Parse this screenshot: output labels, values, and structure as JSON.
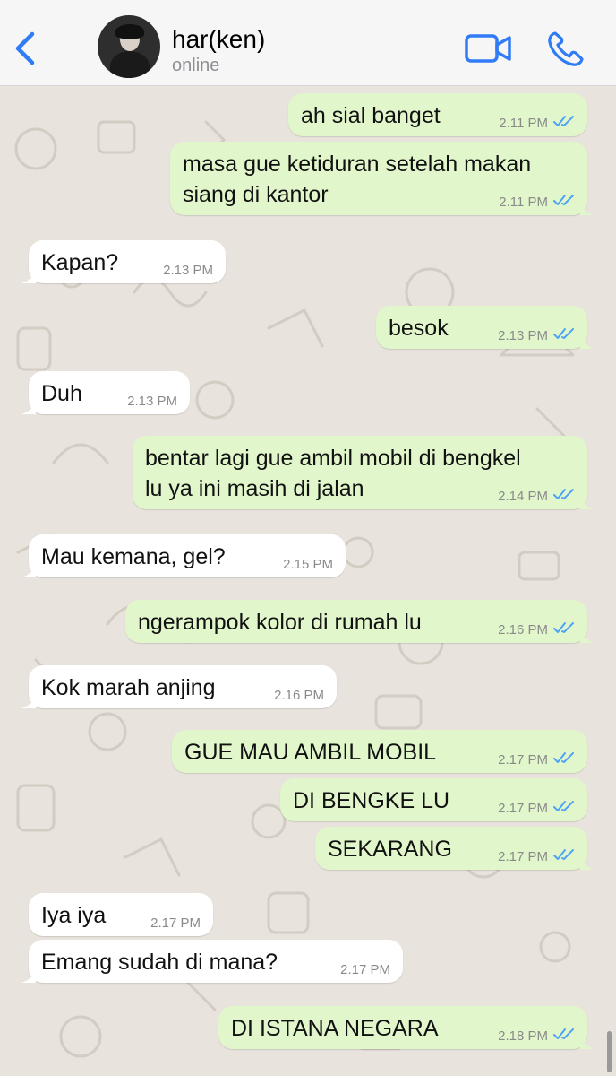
{
  "header": {
    "contact_name": "har(ken)",
    "status": "online"
  },
  "icons": {
    "back": "chevron-left-icon",
    "video": "video-camera-icon",
    "call": "phone-icon",
    "read": "double-check-icon"
  },
  "colors": {
    "accent": "#2f7cf6",
    "outgoing_bubble": "#e1f7cb",
    "incoming_bubble": "#ffffff",
    "read_ticks": "#4fa3f7",
    "chat_background": "#e8e3dc"
  },
  "messages": [
    {
      "direction": "out",
      "text": "ah sial banget",
      "time": "2.11 PM",
      "read": true
    },
    {
      "direction": "out",
      "text": "masa gue ketiduran setelah makan\nsiang di kantor",
      "time": "2.11 PM",
      "read": true
    },
    {
      "direction": "in",
      "text": "Kapan?",
      "time": "2.13 PM"
    },
    {
      "direction": "out",
      "text": "besok",
      "time": "2.13 PM",
      "read": true
    },
    {
      "direction": "in",
      "text": "Duh",
      "time": "2.13 PM"
    },
    {
      "direction": "out",
      "text": "bentar lagi gue ambil mobil di bengkel\nlu ya ini masih di jalan",
      "time": "2.14 PM",
      "read": true
    },
    {
      "direction": "in",
      "text": "Mau kemana, gel?",
      "time": "2.15 PM"
    },
    {
      "direction": "out",
      "text": "ngerampok kolor di rumah lu",
      "time": "2.16 PM",
      "read": true
    },
    {
      "direction": "in",
      "text": "Kok marah anjing",
      "time": "2.16 PM"
    },
    {
      "direction": "out",
      "text": "GUE MAU AMBIL MOBIL",
      "time": "2.17 PM",
      "read": true
    },
    {
      "direction": "out",
      "text": "DI BENGKE LU",
      "time": "2.17 PM",
      "read": true
    },
    {
      "direction": "out",
      "text": "SEKARANG",
      "time": "2.17 PM",
      "read": true
    },
    {
      "direction": "in",
      "text": "Iya iya",
      "time": "2.17 PM"
    },
    {
      "direction": "in",
      "text": "Emang sudah di mana?",
      "time": "2.17 PM"
    },
    {
      "direction": "out",
      "text": "DI ISTANA NEGARA",
      "time": "2.18 PM",
      "read": true
    }
  ]
}
